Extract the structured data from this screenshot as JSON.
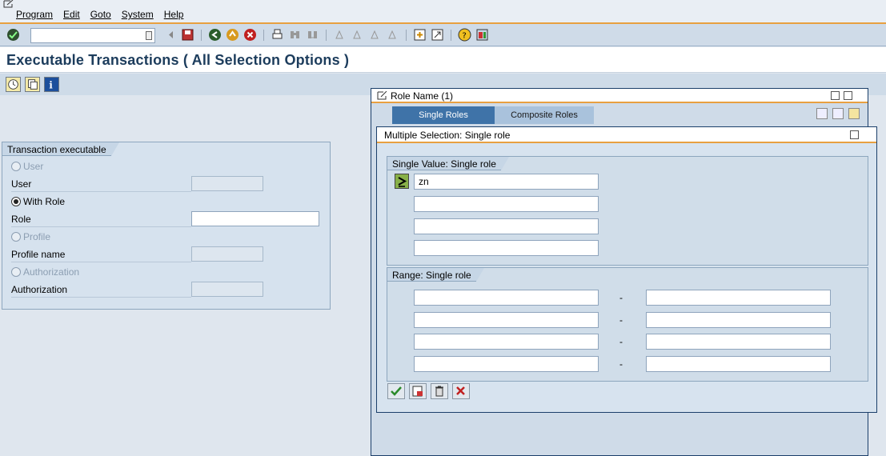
{
  "menu": {
    "items": [
      "Program",
      "Edit",
      "Goto",
      "System",
      "Help"
    ]
  },
  "toolbar": {
    "command_field": ""
  },
  "page": {
    "title": "Executable Transactions ( All Selection Options )"
  },
  "left_group": {
    "title": "Transaction executable",
    "options": [
      {
        "label": "User",
        "selected": false,
        "enabled": false
      },
      {
        "label": "With Role",
        "selected": true,
        "enabled": true
      },
      {
        "label": "Profile",
        "selected": false,
        "enabled": false
      },
      {
        "label": "Authorization",
        "selected": false,
        "enabled": false
      }
    ],
    "fields": [
      {
        "label": "User",
        "value": ""
      },
      {
        "label": "Role",
        "value": ""
      },
      {
        "label": "Profile name",
        "value": ""
      },
      {
        "label": "Authorization",
        "value": ""
      }
    ]
  },
  "role_dialog": {
    "title": "Role Name (1)",
    "tabs": [
      "Single Roles",
      "Composite Roles"
    ]
  },
  "multi_dialog": {
    "title": "Multiple Selection: Single role",
    "single_group_title": "Single Value: Single role",
    "single_values": [
      "zn",
      "",
      "",
      ""
    ],
    "range_group_title": "Range: Single role",
    "range_separator": "-",
    "ranges": [
      [
        "",
        ""
      ],
      [
        "",
        ""
      ],
      [
        "",
        ""
      ],
      [
        "",
        ""
      ]
    ]
  },
  "colors": {
    "accent_orange": "#e8a040",
    "active_tab": "#3f73a8",
    "title_text": "#1c3c5c"
  }
}
